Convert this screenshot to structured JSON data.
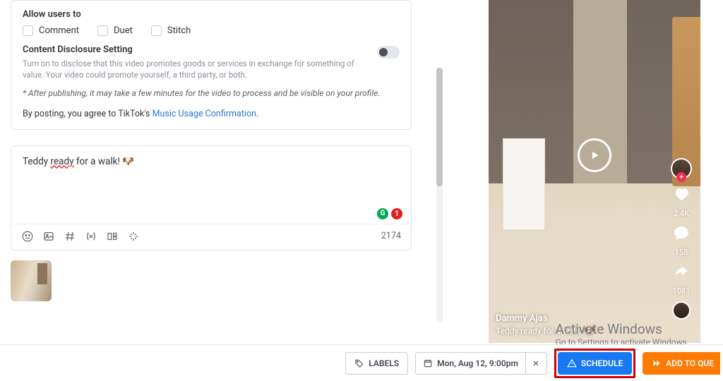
{
  "settings": {
    "allow_title": "Allow users to",
    "options": {
      "comment": "Comment",
      "duet": "Duet",
      "stitch": "Stitch"
    },
    "disclosure_title": "Content Disclosure Setting",
    "disclosure_desc": "Turn on to disclose that this video promotes goods or services in exchange for something of value. Your video could promote yourself, a third party, or both.",
    "processing_note": "* After publishing, it may take a few minutes for the video to process and be visible on your profile.",
    "agree_prefix": "By posting, you agree to TikTok's ",
    "agree_link": "Music Usage Confirmation"
  },
  "composer": {
    "caption_html": "Teddy <span class='underline-red'>ready</span> for a walk! 🐶",
    "char_count": "2174",
    "grammarly_count": "1"
  },
  "preview": {
    "username": "Dammy Ajas",
    "caption": "Teddy ready for a walk! 🐶",
    "likes": "2.4K",
    "comments": "158",
    "shares": "1081"
  },
  "watermark": {
    "title": "Activate Windows",
    "sub": "Go to Settings to activate Windows."
  },
  "footer": {
    "labels": "LABELS",
    "datetime": "Mon, Aug 12, 9:00pm",
    "schedule": "SCHEDULE",
    "queue": "ADD TO QUE"
  }
}
